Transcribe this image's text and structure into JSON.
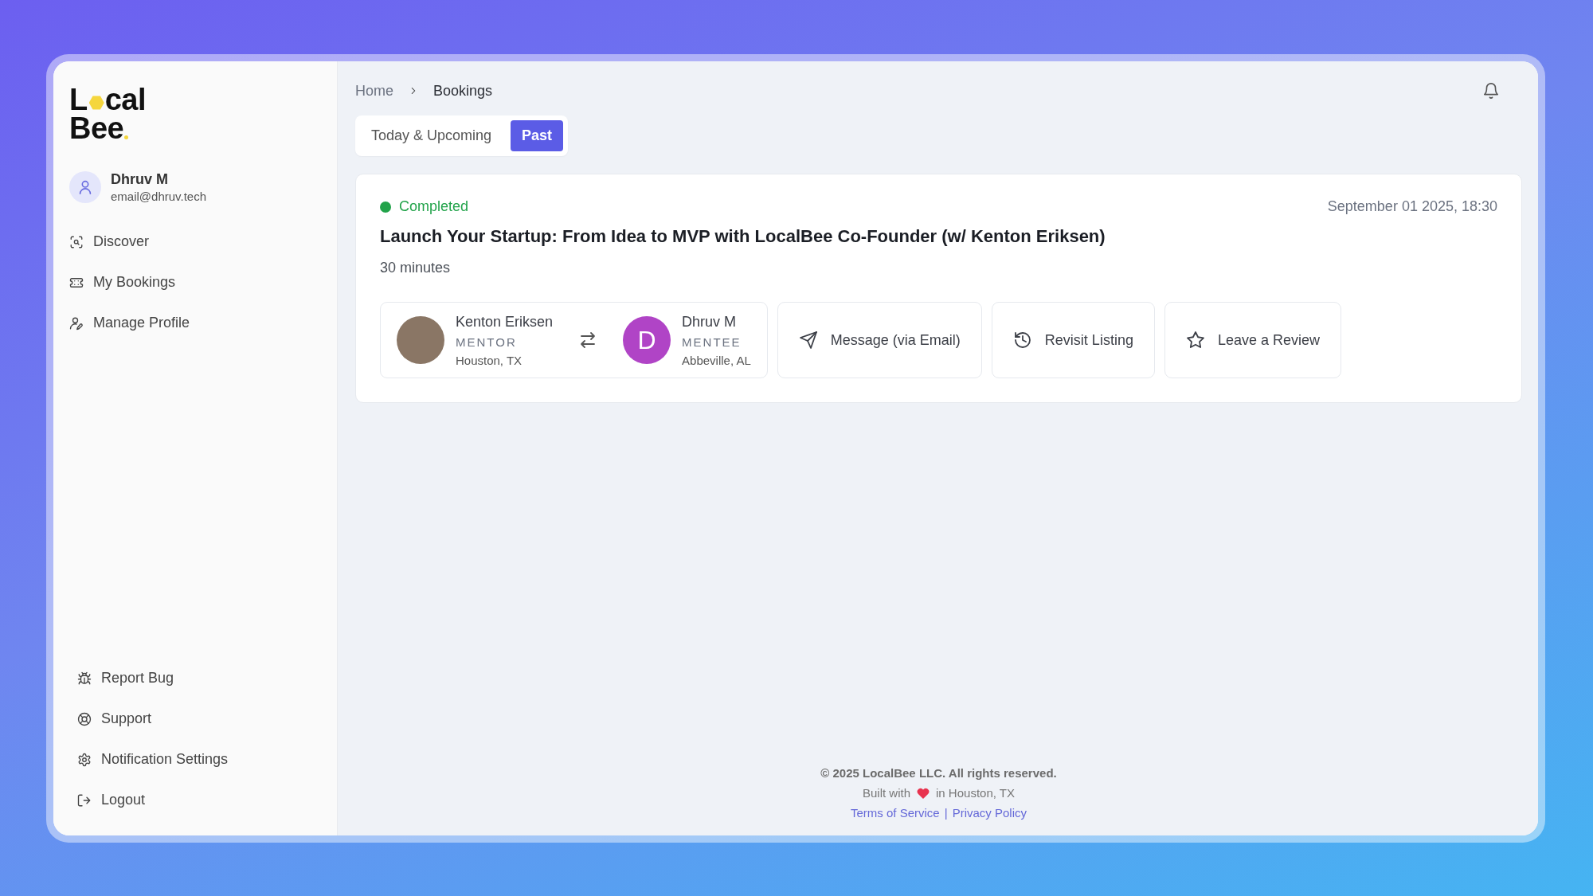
{
  "logo": {
    "before_mark": "L",
    "after_mark": "cal",
    "second_line": "Bee"
  },
  "user": {
    "name": "Dhruv M",
    "email": "email@dhruv.tech"
  },
  "nav": [
    {
      "label": "Discover"
    },
    {
      "label": "My Bookings"
    },
    {
      "label": "Manage Profile"
    }
  ],
  "bottom_nav": [
    {
      "label": "Report Bug"
    },
    {
      "label": "Support"
    },
    {
      "label": "Notification Settings"
    },
    {
      "label": "Logout"
    }
  ],
  "breadcrumb": [
    "Home",
    "Bookings"
  ],
  "tabs": [
    {
      "label": "Today & Upcoming",
      "selected": false
    },
    {
      "label": "Past",
      "selected": true
    }
  ],
  "booking": {
    "status": {
      "label": "Completed",
      "color": "#22a34a"
    },
    "datetime": "September 01 2025, 18:30",
    "title": "Launch Your Startup: From Idea to MVP with LocalBee Co-Founder (w/ Kenton Eriksen)",
    "duration": "30 minutes",
    "participants": [
      {
        "kind": "photo",
        "name": "Kenton Eriksen",
        "role": "MENTOR",
        "location": "Houston, TX"
      },
      {
        "kind": "initial",
        "initial": "D",
        "name": "Dhruv M",
        "role": "MENTEE",
        "location": "Abbeville, AL"
      }
    ],
    "actions": [
      {
        "label": "Message (via Email)"
      },
      {
        "label": "Revisit Listing"
      },
      {
        "label": "Leave a Review"
      }
    ]
  },
  "footer": {
    "copyright": "© 2025 LocalBee LLC. All rights reserved.",
    "built_before": "Built with",
    "built_after": "in Houston, TX",
    "links": [
      "Terms of Service",
      "Privacy Policy"
    ],
    "separator": "|"
  }
}
